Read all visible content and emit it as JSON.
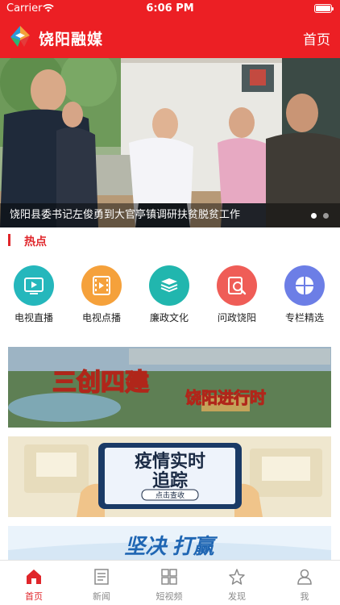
{
  "status_bar": {
    "carrier": "Carrier",
    "time": "6:06 PM"
  },
  "header": {
    "title": "饶阳融媒",
    "home_link": "首页"
  },
  "banner": {
    "caption": "饶阳县委书记左俊勇到大官亭镇调研扶贫脱贫工作",
    "slide_index": 1,
    "slide_count": 2
  },
  "section": {
    "title": "热点"
  },
  "features": [
    {
      "label": "电视直播",
      "icon": "tv-play-icon",
      "color": "#25b7bc"
    },
    {
      "label": "电视点播",
      "icon": "film-icon",
      "color": "#f5a13b"
    },
    {
      "label": "廉政文化",
      "icon": "books-icon",
      "color": "#21b6ae"
    },
    {
      "label": "问政饶阳",
      "icon": "document-search-icon",
      "color": "#ef5d57"
    },
    {
      "label": "专栏精选",
      "icon": "grid-four-icon",
      "color": "#6c7ee6"
    }
  ],
  "promos": [
    {
      "text_left": "三创四建",
      "text_right": "饶阳进行时"
    },
    {
      "line1": "疫情实时",
      "line2": "追踪",
      "button": "点击查收"
    },
    {
      "text": "坚决 打赢"
    }
  ],
  "tabbar": {
    "items": [
      {
        "label": "首页",
        "icon": "home-icon",
        "active": true
      },
      {
        "label": "新闻",
        "icon": "news-icon",
        "active": false
      },
      {
        "label": "短视频",
        "icon": "grid-icon",
        "active": false
      },
      {
        "label": "发现",
        "icon": "discover-icon",
        "active": false
      },
      {
        "label": "我",
        "icon": "user-icon",
        "active": false
      }
    ]
  },
  "colors": {
    "brand_red": "#ec1f24",
    "accent_red": "#e0262b",
    "inactive_gray": "#8a8a8a"
  }
}
